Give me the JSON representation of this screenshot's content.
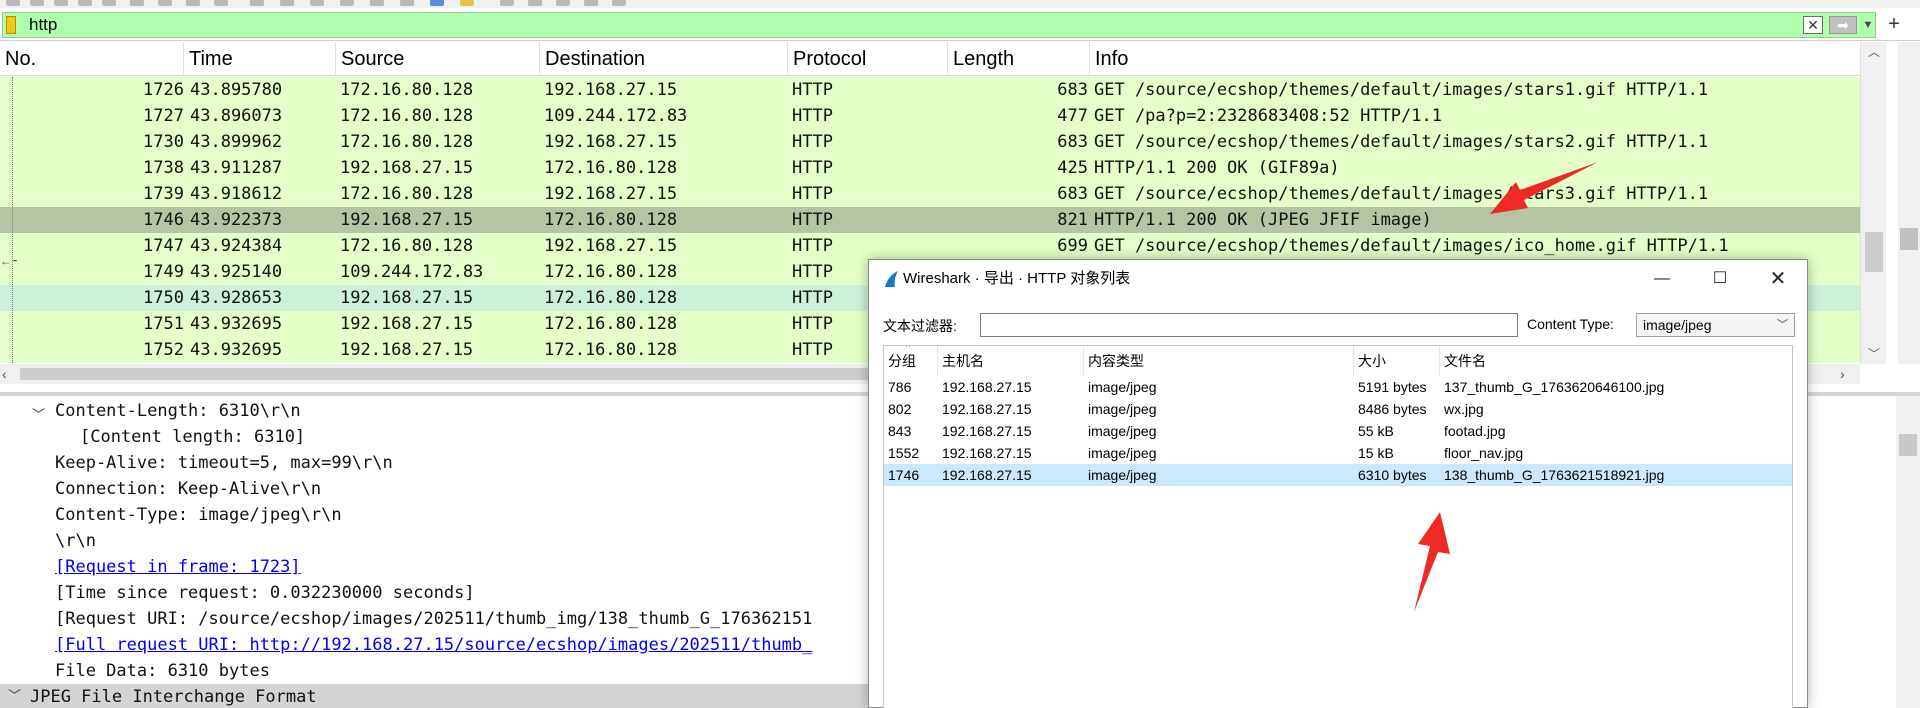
{
  "filter": {
    "value": "http"
  },
  "packet_list": {
    "columns": [
      "No.",
      "Time",
      "Source",
      "Destination",
      "Protocol",
      "Length",
      "Info"
    ],
    "rows": [
      {
        "no": "1726",
        "time": "43.895780",
        "src": "172.16.80.128",
        "dst": "192.168.27.15",
        "proto": "HTTP",
        "len": "683",
        "info": "GET /source/ecshop/themes/default/images/stars1.gif HTTP/1.1"
      },
      {
        "no": "1727",
        "time": "43.896073",
        "src": "172.16.80.128",
        "dst": "109.244.172.83",
        "proto": "HTTP",
        "len": "477",
        "info": "GET /pa?p=2:2328683408:52 HTTP/1.1"
      },
      {
        "no": "1730",
        "time": "43.899962",
        "src": "172.16.80.128",
        "dst": "192.168.27.15",
        "proto": "HTTP",
        "len": "683",
        "info": "GET /source/ecshop/themes/default/images/stars2.gif HTTP/1.1"
      },
      {
        "no": "1738",
        "time": "43.911287",
        "src": "192.168.27.15",
        "dst": "172.16.80.128",
        "proto": "HTTP",
        "len": "425",
        "info": "HTTP/1.1 200 OK  (GIF89a)"
      },
      {
        "no": "1739",
        "time": "43.918612",
        "src": "172.16.80.128",
        "dst": "192.168.27.15",
        "proto": "HTTP",
        "len": "683",
        "info": "GET /source/ecshop/themes/default/images/stars3.gif HTTP/1.1"
      },
      {
        "no": "1746",
        "time": "43.922373",
        "src": "192.168.27.15",
        "dst": "172.16.80.128",
        "proto": "HTTP",
        "len": "821",
        "info": "HTTP/1.1 200 OK  (JPEG JFIF image)"
      },
      {
        "no": "1747",
        "time": "43.924384",
        "src": "172.16.80.128",
        "dst": "192.168.27.15",
        "proto": "HTTP",
        "len": "699",
        "info": "GET /source/ecshop/themes/default/images/ico_home.gif HTTP/1.1"
      },
      {
        "no": "1749",
        "time": "43.925140",
        "src": "109.244.172.83",
        "dst": "172.16.80.128",
        "proto": "HTTP",
        "len": "",
        "info": ""
      },
      {
        "no": "1750",
        "time": "43.928653",
        "src": "192.168.27.15",
        "dst": "172.16.80.128",
        "proto": "HTTP",
        "len": "",
        "info": ""
      },
      {
        "no": "1751",
        "time": "43.932695",
        "src": "192.168.27.15",
        "dst": "172.16.80.128",
        "proto": "HTTP",
        "len": "",
        "info": ""
      },
      {
        "no": "1752",
        "time": "43.932695",
        "src": "192.168.27.15",
        "dst": "172.16.80.128",
        "proto": "HTTP",
        "len": "",
        "info": ""
      }
    ]
  },
  "details": {
    "lines": [
      "Content-Length: 6310\\r\\n",
      "[Content length: 6310]",
      "Keep-Alive: timeout=5, max=99\\r\\n",
      "Connection: Keep-Alive\\r\\n",
      "Content-Type: image/jpeg\\r\\n",
      "\\r\\n",
      "[Request in frame: 1723]",
      "[Time since request: 0.032230000 seconds]",
      "[Request URI: /source/ecshop/images/202511/thumb_img/138_thumb_G_176362151",
      "[Full request URI: http://192.168.27.15/source/ecshop/images/202511/thumb_",
      "File Data: 6310 bytes",
      "JPEG File Interchange Format"
    ]
  },
  "dialog": {
    "title": "Wireshark · 导出 · HTTP 对象列表",
    "filter_label": "文本过滤器:",
    "filter_value": "",
    "content_type_label": "Content Type:",
    "content_type_value": "image/jpeg",
    "columns": [
      "分组",
      "主机名",
      "内容类型",
      "大小",
      "文件名"
    ],
    "rows": [
      {
        "packet": "786",
        "host": "192.168.27.15",
        "type": "image/jpeg",
        "size": "5191 bytes",
        "file": "137_thumb_G_1763620646100.jpg"
      },
      {
        "packet": "802",
        "host": "192.168.27.15",
        "type": "image/jpeg",
        "size": "8486 bytes",
        "file": "wx.jpg"
      },
      {
        "packet": "843",
        "host": "192.168.27.15",
        "type": "image/jpeg",
        "size": "55 kB",
        "file": "footad.jpg"
      },
      {
        "packet": "1552",
        "host": "192.168.27.15",
        "type": "image/jpeg",
        "size": "15 kB",
        "file": "floor_nav.jpg"
      },
      {
        "packet": "1746",
        "host": "192.168.27.15",
        "type": "image/jpeg",
        "size": "6310 bytes",
        "file": "138_thumb_G_1763621518921.jpg"
      }
    ]
  },
  "colors": {
    "filter_bg": "#afffaf",
    "http_row": "#e4ffc7",
    "selected_row": "#b5c5a3",
    "dialog_selected": "#cce8ff",
    "annotation_arrow": "#ee2a24"
  }
}
